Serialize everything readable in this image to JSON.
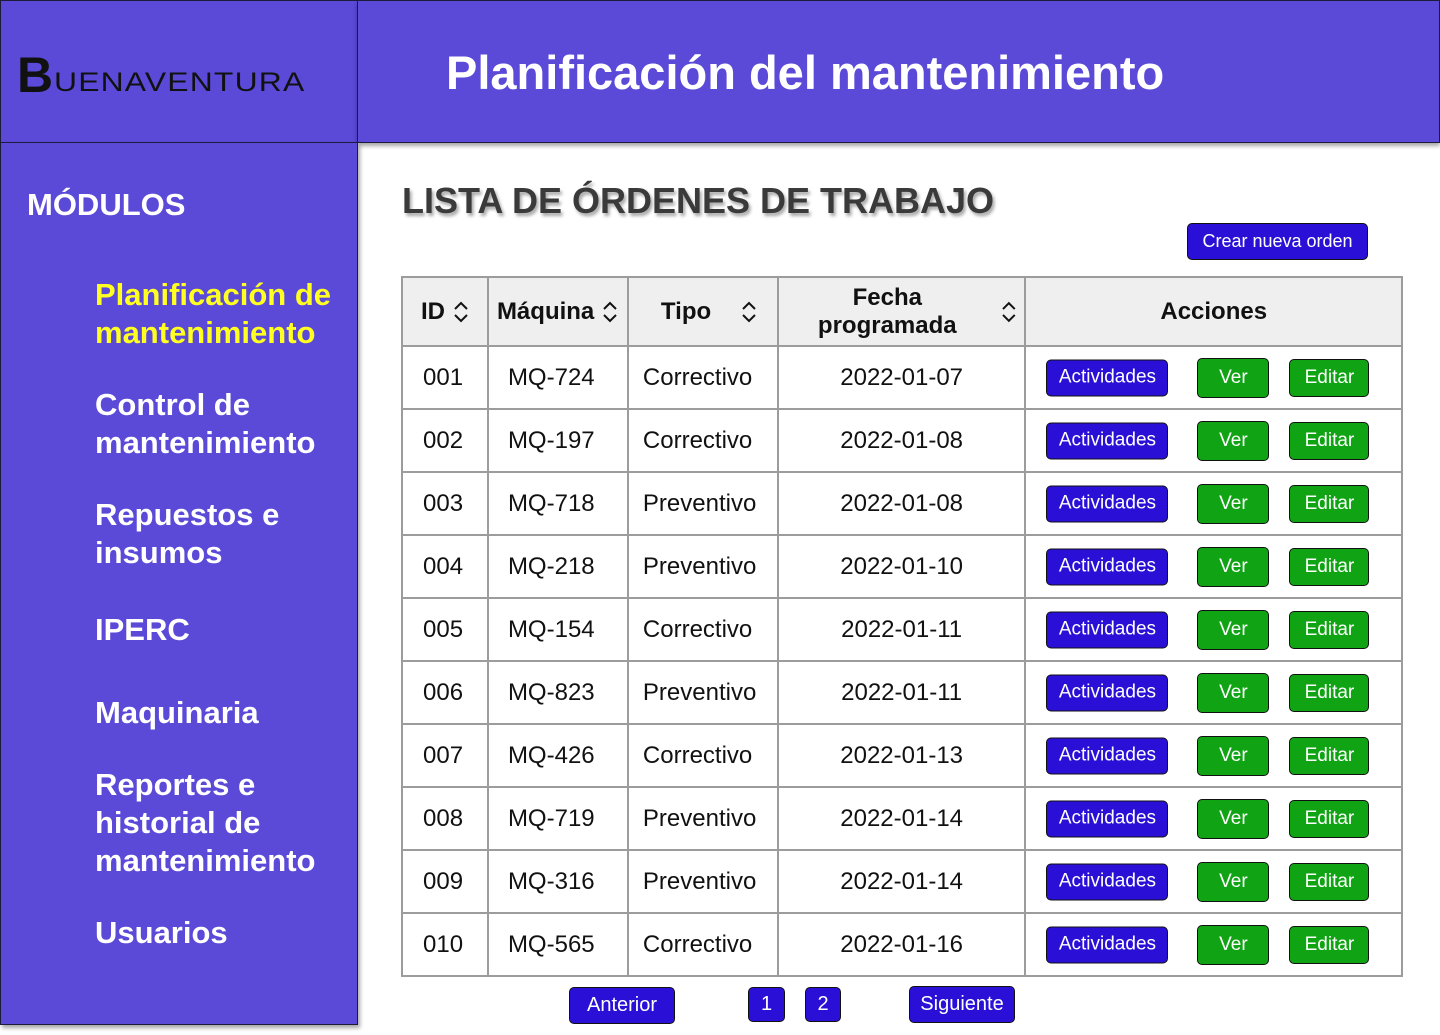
{
  "brand": {
    "logo_initial": "B",
    "logo_rest": "UENAVENTURA"
  },
  "header": {
    "title": "Planificación del mantenimiento"
  },
  "sidebar": {
    "title": "MÓDULOS",
    "items": [
      {
        "label": "Planificación de mantenimiento",
        "active": true
      },
      {
        "label": "Control de mantenimiento",
        "active": false
      },
      {
        "label": "Repuestos e insumos",
        "active": false
      },
      {
        "label": "IPERC",
        "active": false
      },
      {
        "label": "Maquinaria",
        "active": false
      },
      {
        "label": "Reportes e historial de mantenimiento",
        "active": false
      },
      {
        "label": "Usuarios",
        "active": false
      }
    ]
  },
  "main": {
    "title": "LISTA DE ÓRDENES DE TRABAJO",
    "create_button": "Crear nueva orden",
    "columns": [
      "ID",
      "Máquina",
      "Tipo",
      "Fecha programada",
      "Acciones"
    ],
    "row_actions": {
      "activities": "Actividades",
      "view": "Ver",
      "edit": "Editar"
    },
    "rows": [
      {
        "id": "001",
        "maquina": "MQ-724",
        "tipo": "Correctivo",
        "fecha": "2022-01-07"
      },
      {
        "id": "002",
        "maquina": "MQ-197",
        "tipo": "Correctivo",
        "fecha": "2022-01-08"
      },
      {
        "id": "003",
        "maquina": "MQ-718",
        "tipo": "Preventivo",
        "fecha": "2022-01-08"
      },
      {
        "id": "004",
        "maquina": "MQ-218",
        "tipo": "Preventivo",
        "fecha": "2022-01-10"
      },
      {
        "id": "005",
        "maquina": "MQ-154",
        "tipo": "Correctivo",
        "fecha": "2022-01-11"
      },
      {
        "id": "006",
        "maquina": "MQ-823",
        "tipo": "Preventivo",
        "fecha": "2022-01-11"
      },
      {
        "id": "007",
        "maquina": "MQ-426",
        "tipo": "Correctivo",
        "fecha": "2022-01-13"
      },
      {
        "id": "008",
        "maquina": "MQ-719",
        "tipo": "Preventivo",
        "fecha": "2022-01-14"
      },
      {
        "id": "009",
        "maquina": "MQ-316",
        "tipo": "Preventivo",
        "fecha": "2022-01-14"
      },
      {
        "id": "010",
        "maquina": "MQ-565",
        "tipo": "Correctivo",
        "fecha": "2022-01-16"
      }
    ],
    "pagination": {
      "prev": "Anterior",
      "pages": [
        "1",
        "2"
      ],
      "next": "Siguiente"
    }
  },
  "colors": {
    "brand_purple": "#5b4ad8",
    "active_nav": "#ffff22",
    "primary_button": "#2a10d6",
    "success_button": "#10a414"
  },
  "icons": {
    "sort": "sort-updown-icon"
  }
}
